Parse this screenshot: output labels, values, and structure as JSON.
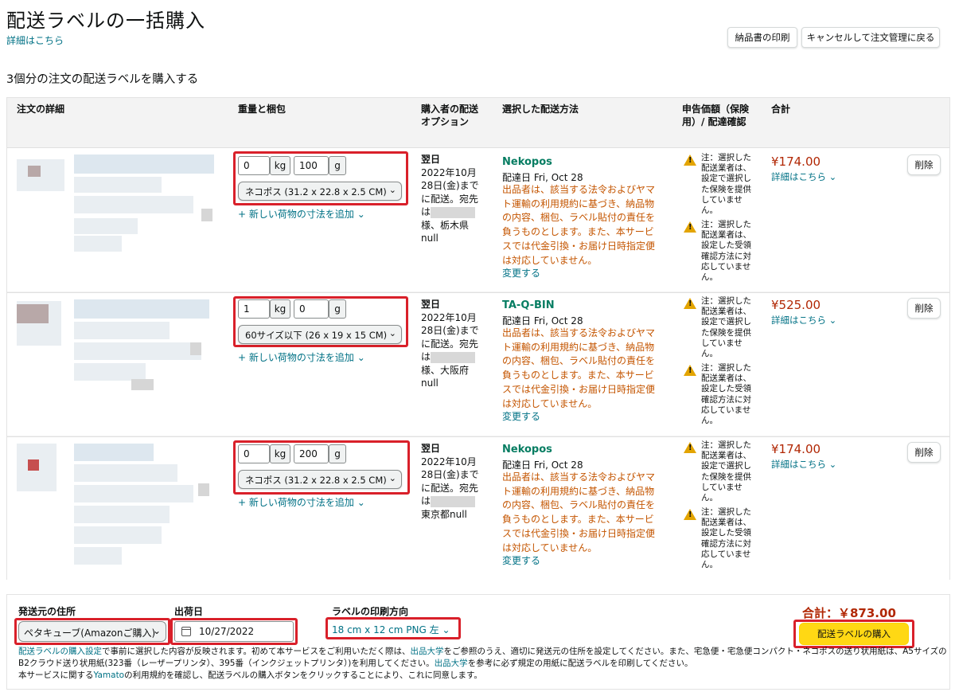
{
  "header": {
    "title": "配送ラベルの一括購入",
    "details_link": "詳細はこちら",
    "btn_print_invoice": "納品書の印刷",
    "btn_cancel": "キャンセルして注文管理に戻る"
  },
  "subtitle": "3個分の注文の配送ラベルを購入する",
  "table": {
    "headers": {
      "order_details": "注文の詳細",
      "weight_packaging": "重量と梱包",
      "buyer_option": "購入者の配送オプション",
      "shipping_method": "選択した配送方法",
      "declared_value": "申告価額（保険用）/ 配達確認",
      "total": "合計"
    },
    "rows": [
      {
        "kg": "0",
        "kg_unit": "kg",
        "g": "100",
        "g_unit": "g",
        "package": "ネコポス (31.2 x 22.8 x 2.5 CM)",
        "add_dims": "+ 新しい荷物の寸法を追加",
        "buyer_option": "翌日",
        "buyer_date": "2022年10月28日(金)までに配送。宛先は",
        "buyer_addr": "様、栃木県null",
        "carrier": "Nekopos",
        "delivery": "配達日 Fri, Oct 28",
        "warning": "出品者は、該当する法令およびヤマト運輸の利用規約に基づき、納品物の内容、梱包、ラベル貼付の責任を負うものとします。また、本サービスでは代金引換・お届け日時指定便は対応していません。",
        "change": "変更する",
        "note1": "注：選択した配送業者は、設定で選択した保険を提供していません。",
        "note2": "注：選択した配送業者は、設定した受領確認方法に対応していません。",
        "price": "¥174.00",
        "price_link": "詳細はこちら",
        "delete": "削除"
      },
      {
        "kg": "1",
        "kg_unit": "kg",
        "g": "0",
        "g_unit": "g",
        "package": "60サイズ以下 (26 x 19 x 15 CM)",
        "add_dims": "+ 新しい荷物の寸法を追加",
        "buyer_option": "翌日",
        "buyer_date": "2022年10月28日(金)までに配送。宛先は",
        "buyer_addr": "様、大阪府null",
        "carrier": "TA-Q-BIN",
        "delivery": "配達日 Fri, Oct 28",
        "warning": "出品者は、該当する法令およびヤマト運輸の利用規約に基づき、納品物の内容、梱包、ラベル貼付の責任を負うものとします。また、本サービスでは代金引換・お届け日時指定便は対応していません。",
        "change": "変更する",
        "note1": "注：選択した配送業者は、設定で選択した保険を提供していません。",
        "note2": "注：選択した配送業者は、設定した受領確認方法に対応していません。",
        "price": "¥525.00",
        "price_link": "詳細はこちら",
        "delete": "削除"
      },
      {
        "kg": "0",
        "kg_unit": "kg",
        "g": "200",
        "g_unit": "g",
        "package": "ネコポス (31.2 x 22.8 x 2.5 CM)",
        "add_dims": "+ 新しい荷物の寸法を追加",
        "buyer_option": "翌日",
        "buyer_date": "2022年10月28日(金)までに配送。宛先は",
        "buyer_addr": "東京都null",
        "carrier": "Nekopos",
        "delivery": "配達日 Fri, Oct 28",
        "warning": "出品者は、該当する法令およびヤマト運輸の利用規約に基づき、納品物の内容、梱包、ラベル貼付の責任を負うものとします。また、本サービスでは代金引換・お届け日時指定便は対応していません。",
        "change": "変更する",
        "note1": "注：選択した配送業者は、設定で選択した保険を提供していません。",
        "note2": "注：選択した配送業者は、設定した受領確認方法に対応していません。",
        "price": "¥174.00",
        "price_link": "詳細はこちら",
        "delete": "削除"
      }
    ]
  },
  "footer": {
    "ship_from_label": "発送元の住所",
    "ship_from_value": "ペタキューブ(Amazonご購入)",
    "ship_date_label": "出荷日",
    "ship_date_value": "10/27/2022",
    "orientation_label": "ラベルの印刷方向",
    "orientation_value": "18 cm x 12 cm PNG 左",
    "total": "合計：￥873.00",
    "buy_button": "配送ラベルの購入",
    "fine_line1_link": "配送ラベルの購入設定",
    "fine_line1_a": "で事前に選択した内容が反映されます。初めて本サービスをご利用いただく際は、",
    "fine_line1_link2": "出品大学",
    "fine_line1_b": "をご参照のうえ、適切に発送元の住所を設定してください。また、宅急便・宅急便コンパクト・ネコポスの送り状用紙は、A5サイズの",
    "fine_line2_a": "B2クラウド送り状用紙(323番（レーザープリンタ）、395番（インクジェットプリンタ）)を利用してください。",
    "fine_line2_link": "出品大学",
    "fine_line2_b": "を参考に必ず規定の用紙に配送ラベルを印刷してください。",
    "fine_line3_a": "本サービスに関する",
    "fine_line3_link": "Yamato",
    "fine_line3_b": "の利用規約を確認し、配送ラベルの購入ボタンをクリックすることにより、これに同意します。"
  },
  "colors": {
    "link": "#007185",
    "carrier": "#067d62",
    "warning": "#c45500",
    "price": "#b12704",
    "highlight_box": "#d9202a",
    "buy_button": "#ffd814"
  }
}
